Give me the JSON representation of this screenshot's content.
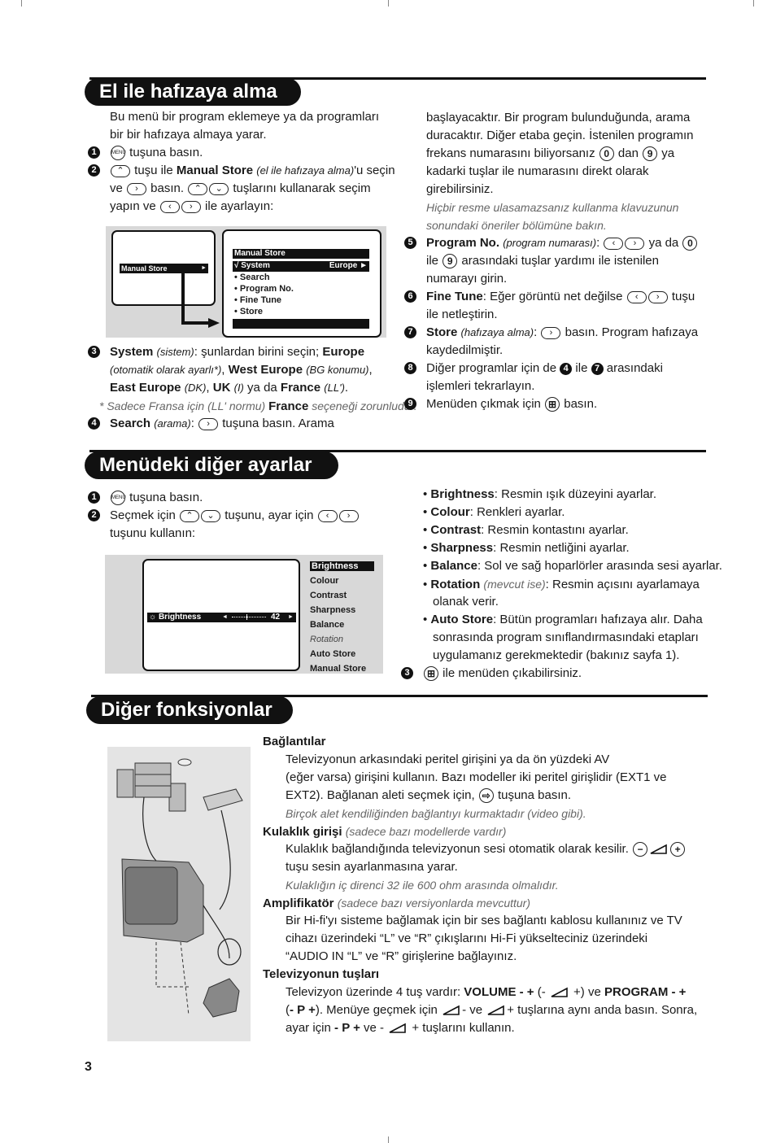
{
  "s1": {
    "title": "El ile hafızaya alma",
    "left": {
      "items": [
        {
          "lines": [
            [
              "Bu menü bir program eklemeye ya da programları"
            ],
            [
              "bir bir hafızaya almaya yarar."
            ]
          ]
        },
        {
          "n": "1",
          "lines": [
            [
              {
                "k": "menu"
              },
              " tuşuna basın."
            ]
          ]
        },
        {
          "n": "2",
          "lines": [
            [
              {
                "k": "up"
              },
              " tuşu ile ",
              {
                "b": "Manual Store"
              },
              " ",
              {
                "i": "(el ile hafızaya alma)"
              },
              "'u seçin"
            ],
            [
              "ve ",
              {
                "k": "right"
              },
              " basın. ",
              {
                "k": "up"
              },
              {
                "k": "down"
              },
              " tuşlarını kullanarak seçim"
            ],
            [
              "yapın ve ",
              {
                "k": "left"
              },
              {
                "k": "right"
              },
              " ile ayarlayın:"
            ]
          ]
        }
      ]
    },
    "left2": {
      "items": [
        {
          "n": "3",
          "lines": [
            [
              {
                "b": "System"
              },
              " ",
              {
                "i": "(sistem)"
              },
              ": şunlardan birini seçin; ",
              {
                "b": "Europe"
              }
            ],
            [
              {
                "i": "(otomatik olarak ayarlı*)"
              },
              ", ",
              {
                "b": "West Europe"
              },
              " ",
              {
                "i": "(BG konumu)"
              },
              ","
            ],
            [
              {
                "b": "East Europe"
              },
              " ",
              {
                "i": "(DK)"
              },
              ", ",
              {
                "b": "UK"
              },
              " ",
              {
                "i": "(I)"
              },
              " ya da ",
              {
                "b": "France"
              },
              " ",
              {
                "i": "(LL')"
              },
              "."
            ]
          ]
        },
        {
          "note": true,
          "lines": [
            [
              {
                "il": "* Sadece Fransa için (LL' normu) "
              },
              {
                "b": "France"
              },
              {
                "il": " seçeneği zorunludur."
              }
            ]
          ]
        },
        {
          "n": "4",
          "lines": [
            [
              {
                "b": "Search"
              },
              " ",
              {
                "i": "(arama)"
              },
              ": ",
              {
                "k": "right"
              },
              " tuşuna basın. Arama"
            ]
          ]
        }
      ]
    },
    "right": {
      "items": [
        {
          "lines": [
            [
              "başlayacaktır. Bir program bulunduğunda, arama"
            ],
            [
              "duracaktır. Diğer etaba geçin. İstenilen programın"
            ],
            [
              "frekans numarasını biliyorsanız ",
              {
                "k": "0"
              },
              " dan ",
              {
                "k": "9"
              },
              " ya"
            ],
            [
              "kadarki tuşlar ile numarasını direkt olarak"
            ],
            [
              "girebilirsiniz."
            ],
            [
              {
                "il": "Hiçbir resme ulasamazsanız kullanma klavuzunun"
              }
            ],
            [
              {
                "il": "sonundaki öneriler bölümüne bakın."
              }
            ]
          ]
        },
        {
          "n": "5",
          "lines": [
            [
              {
                "b": "Program No."
              },
              " ",
              {
                "i": "(program numarası)"
              },
              ": ",
              {
                "k": "left"
              },
              {
                "k": "right"
              },
              " ya da ",
              {
                "k": "0"
              }
            ],
            [
              "ile ",
              {
                "k": "9"
              },
              " arasındaki tuşlar yardımı ile istenilen"
            ],
            [
              "numarayı girin."
            ]
          ]
        },
        {
          "n": "6",
          "lines": [
            [
              {
                "b": "Fine Tune"
              },
              ": Eğer görüntü net değilse ",
              {
                "k": "left"
              },
              {
                "k": "right"
              },
              " tuşu"
            ],
            [
              "ile netleştirin."
            ]
          ]
        },
        {
          "n": "7",
          "lines": [
            [
              {
                "b": "Store"
              },
              " ",
              {
                "i": "(hafızaya alma)"
              },
              ": ",
              {
                "k": "right"
              },
              " basın. Program hafızaya"
            ],
            [
              "kaydedilmiştir."
            ]
          ]
        },
        {
          "n": "8",
          "lines": [
            [
              "Diğer programlar için de ",
              {
                "badge": "4"
              },
              " ile ",
              {
                "badge": "7"
              },
              " arasındaki"
            ],
            [
              "işlemleri tekrarlayın."
            ]
          ]
        },
        {
          "n": "9",
          "lines": [
            [
              "Menüden çıkmak için ",
              {
                "k": "exit"
              },
              " basın."
            ]
          ]
        }
      ]
    },
    "screen": {
      "left_item": "Manual Store",
      "left_arrow": "►",
      "title": "Manual Store",
      "selected": "√ System",
      "selected_value": "Europe ►",
      "items": [
        "• Search",
        "• Program No.",
        "• Fine Tune",
        "• Store"
      ]
    }
  },
  "s2": {
    "title": "Menüdeki diğer ayarlar",
    "left": {
      "items": [
        {
          "n": "1",
          "lines": [
            [
              {
                "k": "menu"
              },
              " tuşuna basın."
            ]
          ]
        },
        {
          "n": "2",
          "lines": [
            [
              "Seçmek için ",
              {
                "k": "up"
              },
              {
                "k": "down"
              },
              " tuşunu, ayar için ",
              {
                "k": "left"
              },
              {
                "k": "right"
              }
            ],
            [
              "tuşunu kullanın:"
            ]
          ]
        }
      ]
    },
    "right": {
      "items": [
        {
          "bullet": true,
          "lines": [
            [
              "• ",
              {
                "b": "Brightness"
              },
              ": Resmin ışık düzeyini ayarlar."
            ]
          ]
        },
        {
          "bullet": true,
          "lines": [
            [
              "• ",
              {
                "b": "Colour"
              },
              ": Renkleri ayarlar."
            ]
          ]
        },
        {
          "bullet": true,
          "lines": [
            [
              "• ",
              {
                "b": "Contrast"
              },
              ": Resmin kontastını ayarlar."
            ]
          ]
        },
        {
          "bullet": true,
          "lines": [
            [
              "• ",
              {
                "b": "Sharpness"
              },
              ": Resmin netliğini ayarlar."
            ]
          ]
        },
        {
          "bullet": true,
          "lines": [
            [
              "• ",
              {
                "b": "Balance"
              },
              ": Sol ve sağ hoparlörler arasında sesi ayarlar."
            ]
          ]
        },
        {
          "bullet": true,
          "lines": [
            [
              "• ",
              {
                "b": "Rotation"
              },
              " ",
              {
                "il": "(mevcut ise)"
              },
              ": Resmin açısını ayarlamaya"
            ],
            [
              "olanak verir."
            ]
          ]
        },
        {
          "bullet": true,
          "lines": [
            [
              "• ",
              {
                "b": "Auto Store"
              },
              ": Bütün programları hafızaya alır. Daha"
            ],
            [
              "sonrasında program sınıflandırmasındaki etapları"
            ],
            [
              "uygulamanız gerekmektedir (bakınız sayfa 1)."
            ]
          ]
        },
        {
          "n": "3",
          "lines": [
            [
              {
                "k": "exit"
              },
              " ile menüden çıkabilirsiniz."
            ]
          ]
        }
      ]
    },
    "screen": {
      "bar_label": "Brightness",
      "bar_value": "42",
      "slider_level": 0.42,
      "menu": [
        "Brightness",
        "Colour",
        "Contrast",
        "Sharpness",
        "Balance",
        "Rotation",
        "Auto Store",
        "Manual Store"
      ],
      "selected": "Brightness"
    }
  },
  "s3": {
    "title": "Diğer fonksiyonlar",
    "body": {
      "items": [
        {
          "lines": [
            [
              {
                "b": "Bağlantılar"
              }
            ]
          ]
        },
        {
          "indent": true,
          "lines": [
            [
              "Televizyonun arkasındaki peritel girişini ya da ön yüzdeki AV"
            ],
            [
              "(eğer varsa) girişini kullanın. Bazı modeller iki peritel girişlidir (EXT1 ve"
            ],
            [
              "EXT2). Bağlanan aleti seçmek için, ",
              {
                "k": "av"
              },
              " tuşuna basın."
            ],
            [
              {
                "il": "Birçok alet kendiliğinden bağlantıyı kurmaktadır (video gibi)."
              }
            ]
          ]
        },
        {
          "lines": [
            [
              {
                "b": "Kulaklık girişi"
              },
              " ",
              {
                "il": "(sadece bazı modellerde vardır)"
              }
            ]
          ]
        },
        {
          "indent": true,
          "lines": [
            [
              "Kulaklık bağlandığında televizyonun sesi otomatik olarak kesilir. ",
              {
                "k": "minus"
              },
              {
                "k": "vol"
              },
              {
                "k": "plus"
              }
            ],
            [
              "tuşu sesin ayarlanmasına yarar."
            ],
            [
              {
                "il": "Kulaklığın iç direnci 32 ile 600 ohm arasında olmalıdır."
              }
            ]
          ]
        },
        {
          "lines": [
            [
              {
                "b": "Amplifikatör"
              },
              " ",
              {
                "il": "(sadece bazı versiyonlarda mevcuttur)"
              }
            ]
          ]
        },
        {
          "indent": true,
          "lines": [
            [
              "Bir Hi-fi'yı sisteme bağlamak için bir ses bağlantı kablosu kullanınız ve TV"
            ],
            [
              "cihazı üzerindeki “L” ve “R” çıkışlarını Hi-Fi yükselteciniz üzerindeki"
            ],
            [
              "“AUDIO IN “L” ve “R” girişlerine bağlayınız."
            ]
          ]
        },
        {
          "lines": [
            [
              {
                "b": "Televizyonun tuşları"
              }
            ]
          ]
        },
        {
          "indent": true,
          "lines": [
            [
              "Televizyon üzerinde 4 tuş vardır: ",
              {
                "b": "VOLUME - +"
              },
              " (- ",
              {
                "k": "vol"
              },
              " +) ve ",
              {
                "b": "PROGRAM - +"
              }
            ],
            [
              "(",
              {
                "b": "- P +"
              },
              "). Menüye geçmek için ",
              {
                "k": "vol"
              },
              "- ve ",
              {
                "k": "vol"
              },
              "+ tuşlarına aynı anda basın. Sonra,"
            ],
            [
              "ayar için ",
              {
                "b": "- P +"
              },
              " ve - ",
              {
                "k": "vol"
              },
              " + tuşlarını kullanın."
            ]
          ]
        }
      ]
    }
  },
  "page_number": "3"
}
